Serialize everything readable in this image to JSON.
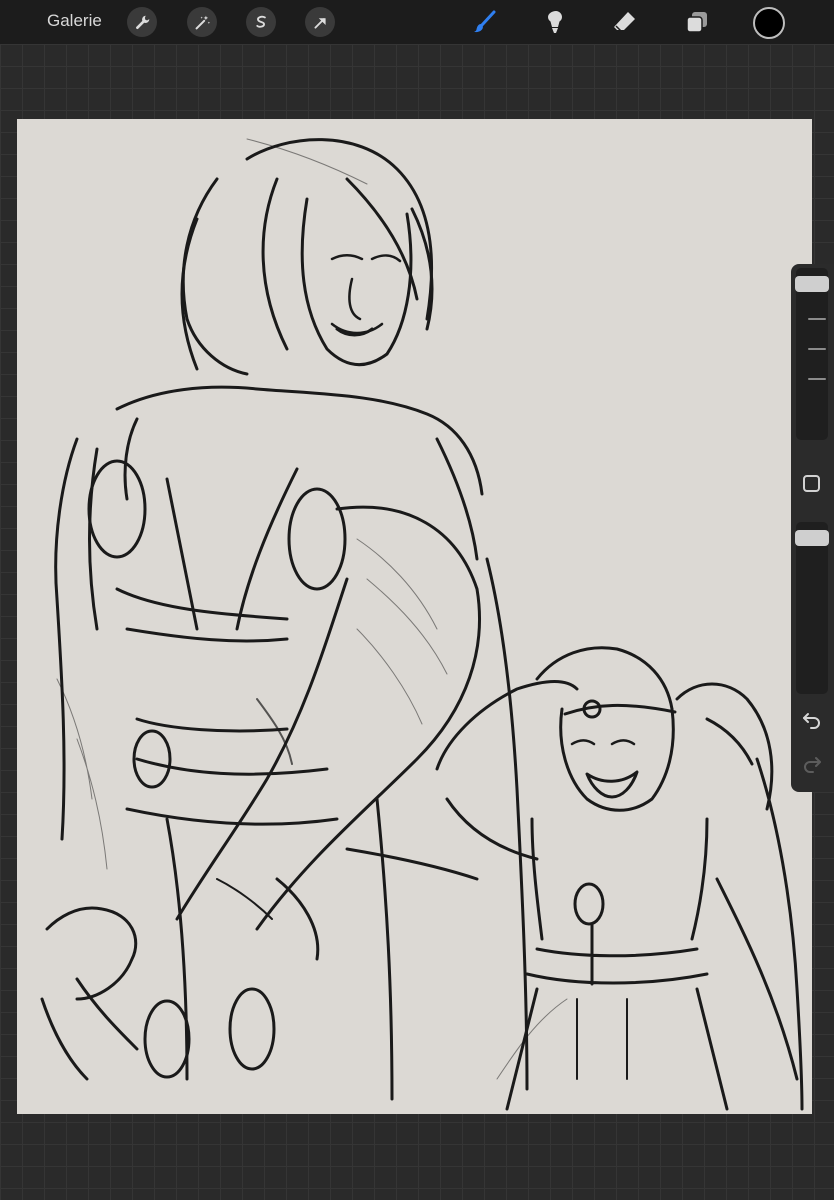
{
  "toolbar": {
    "gallery_label": "Galerie",
    "left_tools": [
      "wrench-icon",
      "magic-wand-icon",
      "selection-icon",
      "transform-arrow-icon"
    ],
    "right_tools": [
      "brush-icon",
      "smudge-icon",
      "eraser-icon",
      "layers-icon"
    ],
    "active_tool": "brush",
    "colors": {
      "active_tool": "#2f7ff0",
      "current_color": "#000000"
    }
  },
  "sidebar": {
    "brush_size_level": 0.05,
    "opacity_level": 0.05,
    "buttons": [
      "modify-button",
      "undo-button",
      "redo-button"
    ]
  }
}
